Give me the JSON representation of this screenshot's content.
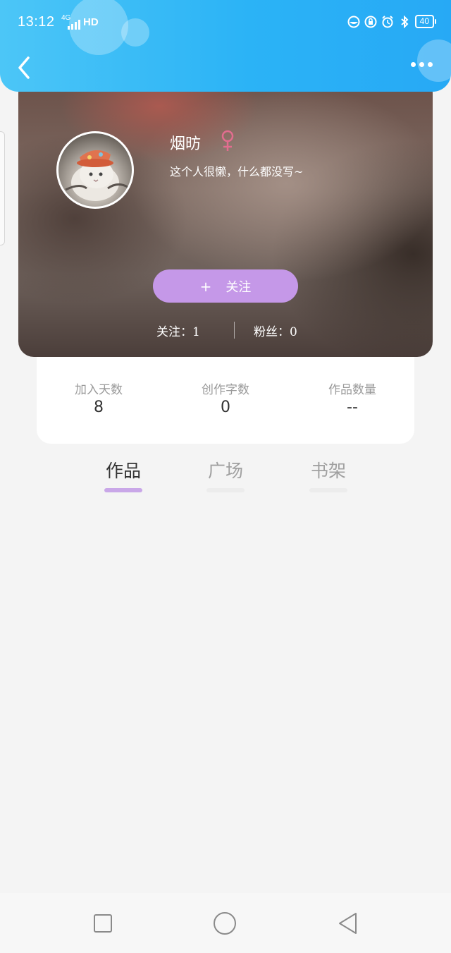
{
  "status_bar": {
    "time": "13:12",
    "network": "4G",
    "hd": "HD",
    "battery": "40"
  },
  "header": {
    "back_icon": "chevron-left-icon",
    "more_icon": "more-dots-icon"
  },
  "profile": {
    "name": "烟昉",
    "gender_icon": "female-icon",
    "bio": "这个人很懒，什么都没写~",
    "follow_plus": "+",
    "follow_label": "关注",
    "following": "关注：1",
    "fans": "粉丝：0",
    "accent_color": "#c598e8"
  },
  "info": [
    {
      "label": "加入天数",
      "value": "8"
    },
    {
      "label": "创作字数",
      "value": "0"
    },
    {
      "label": "作品数量",
      "value": "--"
    }
  ],
  "tabs": [
    {
      "label": "作品",
      "active": true
    },
    {
      "label": "广场",
      "active": false
    },
    {
      "label": "书架",
      "active": false
    }
  ],
  "nav": {
    "recent_icon": "square-icon",
    "home_icon": "circle-icon",
    "back_icon": "triangle-back-icon"
  }
}
